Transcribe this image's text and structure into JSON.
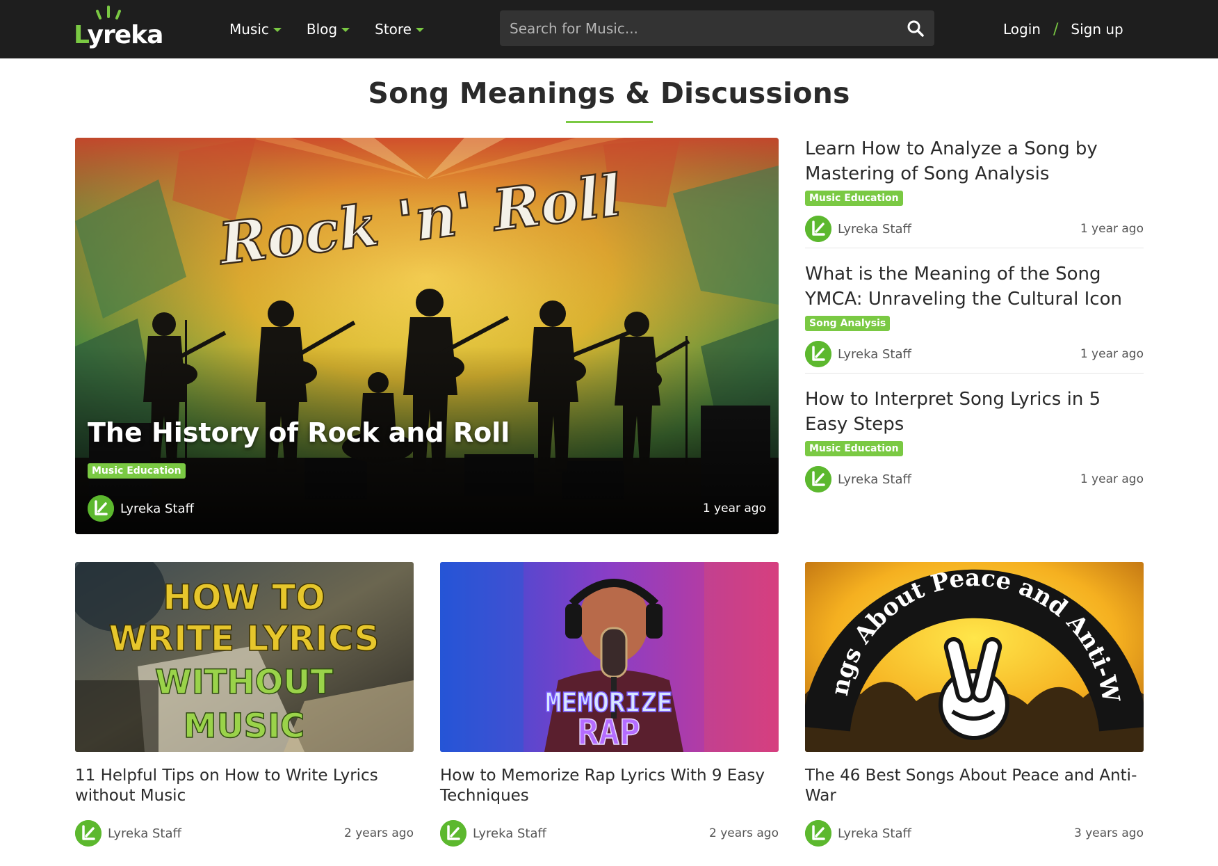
{
  "brand": {
    "name": "Lyreka",
    "accent": "#7ac943",
    "nav_bg": "#1e1e1e"
  },
  "nav": {
    "items": [
      {
        "label": "Music"
      },
      {
        "label": "Blog"
      },
      {
        "label": "Store"
      }
    ],
    "search_placeholder": "Search for Music...",
    "login": "Login",
    "separator": "/",
    "signup": "Sign up"
  },
  "page": {
    "title": "Song Meanings & Discussions"
  },
  "featured": {
    "image_text": "Rock 'n' Roll",
    "title": "The History of Rock and Roll",
    "tag": "Music Education",
    "author": "Lyreka Staff",
    "time": "1 year ago"
  },
  "side_articles": [
    {
      "title": "Learn How to Analyze a Song by Mastering of Song Analysis",
      "tag": "Music Education",
      "author": "Lyreka Staff",
      "time": "1 year ago"
    },
    {
      "title": "What is the Meaning of the Song YMCA: Unraveling the Cultural Icon",
      "tag": "Song Analysis",
      "author": "Lyreka Staff",
      "time": "1 year ago"
    },
    {
      "title": "How to Interpret Song Lyrics in 5 Easy Steps",
      "tag": "Music Education",
      "author": "Lyreka Staff",
      "time": "1 year ago"
    }
  ],
  "cards": [
    {
      "title": "11 Helpful Tips on How to Write Lyrics without Music",
      "image_lines": [
        "HOW TO",
        "WRITE LYRICS",
        "WITHOUT",
        "MUSIC"
      ],
      "author": "Lyreka Staff",
      "time": "2 years ago"
    },
    {
      "title": "How to Memorize Rap Lyrics With 9 Easy Techniques",
      "image_lines": [
        "MEMORIZE",
        "RAP"
      ],
      "author": "Lyreka Staff",
      "time": "2 years ago"
    },
    {
      "title": "The 46 Best Songs About Peace and Anti-War",
      "image_text": "Songs About Peace and Anti-War",
      "author": "Lyreka Staff",
      "time": "3 years ago"
    }
  ]
}
